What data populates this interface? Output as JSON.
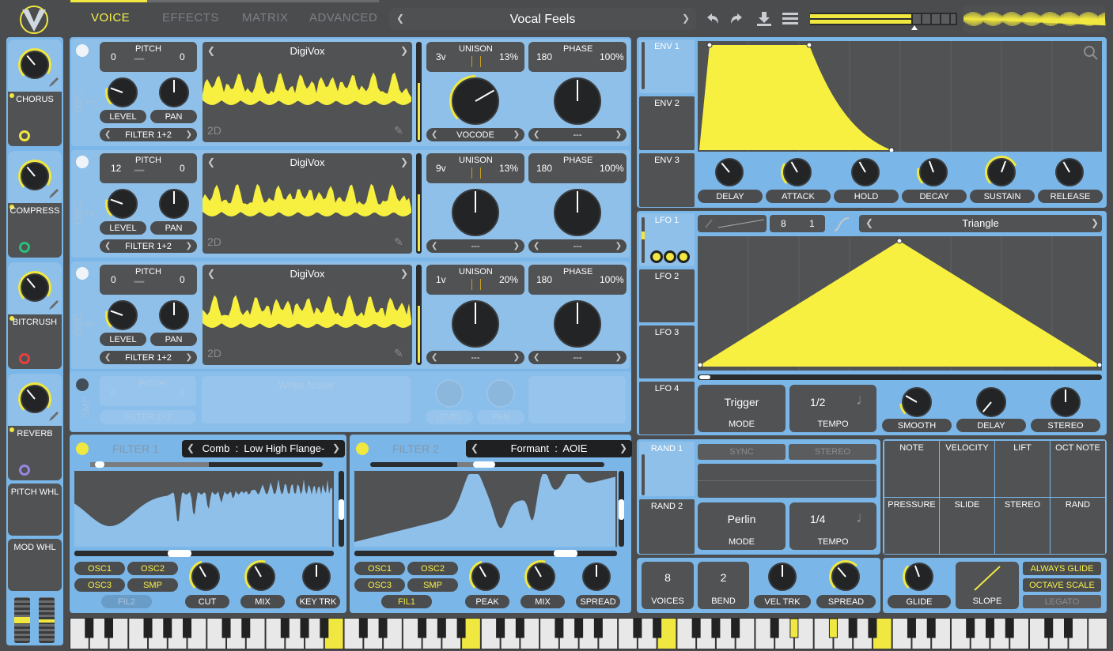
{
  "header": {
    "tabs": [
      "VOICE",
      "EFFECTS",
      "MATRIX",
      "ADVANCED"
    ],
    "active_tab": "VOICE",
    "preset_name": "Vocal Feels"
  },
  "effects": [
    {
      "name": "CHORUS",
      "color": "#f0e840"
    },
    {
      "name": "COMPRESS",
      "color": "#2ac07a"
    },
    {
      "name": "BITCRUSH",
      "color": "#e84040"
    },
    {
      "name": "REVERB",
      "color": "#9a86e0"
    }
  ],
  "wheels": {
    "pitch": "PITCH WHL",
    "mod": "MOD WHL"
  },
  "oscillators": [
    {
      "label": "OSC 1",
      "pitch_left": "0",
      "pitch_right": "0",
      "pitch_title": "PITCH",
      "wavetable": "DigiVox",
      "dim": "2D",
      "unison_voices": "3v",
      "unison_title": "UNISON",
      "unison_detune": "13%",
      "phase": "180",
      "phase_title": "PHASE",
      "phase_rand": "100%",
      "level": "LEVEL",
      "pan": "PAN",
      "filter_route": "FILTER 1+2",
      "distortion": "VOCODE",
      "spectral": "---"
    },
    {
      "label": "OSC 2",
      "pitch_left": "12",
      "pitch_right": "0",
      "pitch_title": "PITCH",
      "wavetable": "DigiVox",
      "dim": "2D",
      "unison_voices": "9v",
      "unison_title": "UNISON",
      "unison_detune": "13%",
      "phase": "180",
      "phase_title": "PHASE",
      "phase_rand": "100%",
      "level": "LEVEL",
      "pan": "PAN",
      "filter_route": "FILTER 1+2",
      "distortion": "---",
      "spectral": "---"
    },
    {
      "label": "OSC 3",
      "pitch_left": "0",
      "pitch_right": "0",
      "pitch_title": "PITCH",
      "wavetable": "DigiVox",
      "dim": "2D",
      "unison_voices": "1v",
      "unison_title": "UNISON",
      "unison_detune": "20%",
      "phase": "180",
      "phase_title": "PHASE",
      "phase_rand": "100%",
      "level": "LEVEL",
      "pan": "PAN",
      "filter_route": "FILTER 1+2",
      "distortion": "---",
      "spectral": "---"
    }
  ],
  "sample": {
    "label": "SMP",
    "pitch_left": "0",
    "pitch_right": "0",
    "pitch_title": "PITCH",
    "name": "White Noise",
    "level": "LEVEL",
    "pan": "PAN",
    "filter_route": "FILTER 1+2"
  },
  "filter1": {
    "title": "FILTER 1",
    "model": "Comb",
    "style": "Low High Flange-",
    "sources": [
      "OSC1",
      "OSC2",
      "OSC3",
      "SMP"
    ],
    "fil": "FIL2",
    "knobs": [
      "CUT",
      "MIX",
      "KEY TRK"
    ]
  },
  "filter2": {
    "title": "FILTER 2",
    "model": "Formant",
    "style": "AOIE",
    "sources": [
      "OSC1",
      "OSC2",
      "OSC3",
      "SMP"
    ],
    "fil": "FIL1",
    "knobs": [
      "PEAK",
      "MIX",
      "SPREAD"
    ]
  },
  "envelopes": {
    "tabs": [
      "ENV 1",
      "ENV 2",
      "ENV 3"
    ],
    "knobs": [
      "DELAY",
      "ATTACK",
      "HOLD",
      "DECAY",
      "SUSTAIN",
      "RELEASE"
    ]
  },
  "lfo": {
    "tabs": [
      "LFO 1",
      "LFO 2",
      "LFO 3",
      "LFO 4"
    ],
    "grid_x": "8",
    "grid_y": "1",
    "shape": "Triangle",
    "mode": "Trigger",
    "mode_label": "MODE",
    "tempo": "1/2",
    "tempo_label": "TEMPO",
    "knobs": [
      "SMOOTH",
      "DELAY",
      "STEREO"
    ]
  },
  "random": {
    "tabs": [
      "RAND 1",
      "RAND 2"
    ],
    "sync": "SYNC",
    "stereo": "STEREO",
    "mode": "Perlin",
    "mode_label": "MODE",
    "tempo": "1/4",
    "tempo_label": "TEMPO"
  },
  "mod_sources": [
    "NOTE",
    "VELOCITY",
    "LIFT",
    "OCT NOTE",
    "PRESSURE",
    "SLIDE",
    "STEREO",
    "RAND"
  ],
  "voice": {
    "voices": "8",
    "voices_label": "VOICES",
    "bend": "2",
    "bend_label": "BEND",
    "vel_trk": "VEL TRK",
    "spread": "SPREAD"
  },
  "glide": {
    "glide": "GLIDE",
    "slope": "SLOPE",
    "always": "ALWAYS GLIDE",
    "octave": "OCTAVE SCALE",
    "legato": "LEGATO"
  }
}
